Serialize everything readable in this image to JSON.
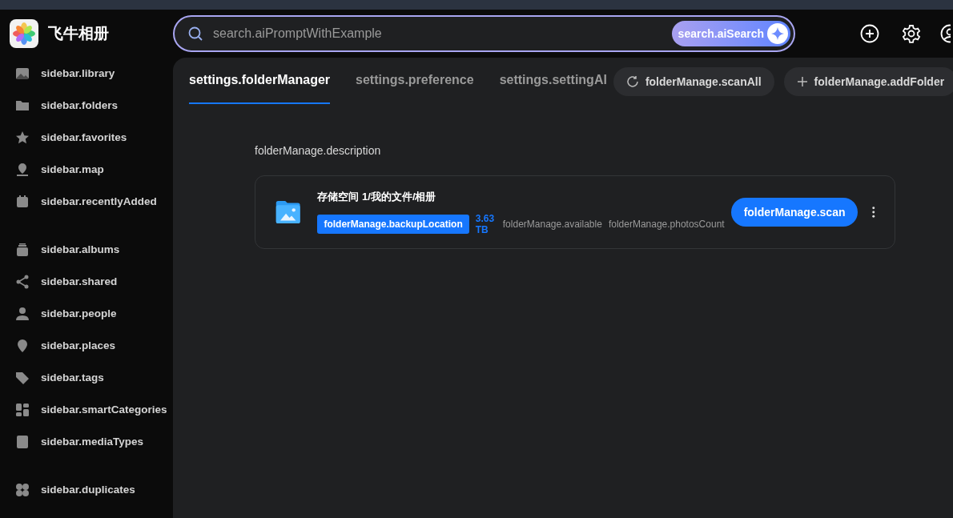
{
  "app": {
    "title": "飞牛相册"
  },
  "search": {
    "placeholder": "search.aiPromptWithExample",
    "button": "search.aiSearch"
  },
  "sidebar": {
    "groups": [
      [
        {
          "label": "sidebar.library"
        },
        {
          "label": "sidebar.folders"
        },
        {
          "label": "sidebar.favorites"
        },
        {
          "label": "sidebar.map"
        },
        {
          "label": "sidebar.recentlyAdded"
        }
      ],
      [
        {
          "label": "sidebar.albums"
        },
        {
          "label": "sidebar.shared"
        },
        {
          "label": "sidebar.people"
        },
        {
          "label": "sidebar.places"
        },
        {
          "label": "sidebar.tags"
        },
        {
          "label": "sidebar.smartCategories"
        },
        {
          "label": "sidebar.mediaTypes"
        }
      ],
      [
        {
          "label": "sidebar.duplicates"
        }
      ]
    ]
  },
  "tabs": [
    {
      "label": "settings.folderManager",
      "selected": true
    },
    {
      "label": "settings.preference",
      "selected": false
    },
    {
      "label": "settings.settingAI",
      "selected": false
    }
  ],
  "actions": [
    {
      "label": "folderManage.scanAll",
      "kind": "scan"
    },
    {
      "label": "folderManage.addFolder",
      "kind": "add"
    }
  ],
  "description": "folderManage.description",
  "folders": [
    {
      "path": "存储空间 1/我的文件/相册",
      "badge": "folderManage.backupLocation",
      "size": "3.63 TB",
      "meta": [
        "folderManage.available",
        "folderManage.photosCount"
      ],
      "button": "folderManage.scan"
    }
  ]
}
